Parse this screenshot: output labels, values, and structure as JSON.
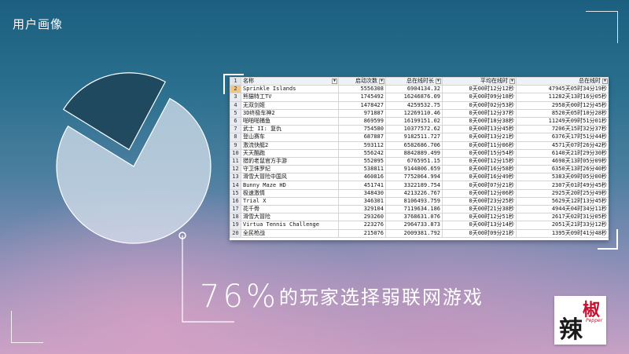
{
  "slide": {
    "title": "用户画像",
    "caption_number": "76%",
    "caption_text": "的玩家选择弱联网游戏"
  },
  "chart_data": {
    "type": "pie",
    "values": [
      76,
      24
    ],
    "colors": [
      "#d7e1ee",
      "#1e4559"
    ]
  },
  "table": {
    "headers": [
      "名称",
      "启动次数",
      "总在线时长",
      "平均在线时",
      "总在线时"
    ],
    "rows": [
      [
        "1",
        "",
        "",
        "",
        "",
        ""
      ],
      [
        "2",
        "Sprinkle Islands",
        "5556308",
        "6904134.32",
        "0天00时12分12秒",
        "47945天05时34分19秒"
      ],
      [
        "3",
        "熊猫特工TV",
        "1745492",
        "16246876.09",
        "0天00时09分18秒",
        "11282天13时16分05秒"
      ],
      [
        "4",
        "无双剑姬",
        "1478427",
        "4259532.75",
        "0天00时02分53秒",
        "2958天00时12分45秒"
      ],
      [
        "5",
        "3D终极车神2",
        "971887",
        "12269110.46",
        "0天00时12分37秒",
        "8520天05时10分28秒"
      ],
      [
        "6",
        "啪啪啪捕鱼",
        "869599",
        "16199151.02",
        "0天00时18分38秒",
        "11249天09时51分01秒"
      ],
      [
        "7",
        "武士 II: 复仇",
        "754580",
        "10377572.62",
        "0天00时13分45秒",
        "7206天15时32分37秒"
      ],
      [
        "8",
        "登山赛车",
        "687887",
        "9182511.727",
        "0天00时13分21秒",
        "6376天17时51分44秒"
      ],
      [
        "9",
        "激流快艇2",
        "593112",
        "6582686.706",
        "0天00时11分06秒",
        "4571天07时26分42秒"
      ],
      [
        "10",
        "天天酷跑",
        "556242",
        "8842889.499",
        "0天00时15分54秒",
        "6140天21时29分30秒"
      ],
      [
        "11",
        "猎豹老鼠官方手游",
        "552095",
        "6765951.15",
        "0天00时12分15秒",
        "4698天13时05分09秒"
      ],
      [
        "12",
        "守卫侏罗纪",
        "538811",
        "9144806.659",
        "0天00时16分58秒",
        "6350天13时26分40秒"
      ],
      [
        "13",
        "滑雪大冒险中国风",
        "460816",
        "7752064.994",
        "0天00时16分49秒",
        "5383天09时05分00秒"
      ],
      [
        "14",
        "Bunny Maze HD",
        "451741",
        "3322189.754",
        "0天00时07分21秒",
        "2307天01时49分45秒"
      ],
      [
        "15",
        "极速激情",
        "348430",
        "4213226.767",
        "0天00时12分06秒",
        "2925天20时25分49秒"
      ],
      [
        "16",
        "Trial X",
        "346301",
        "8106493.759",
        "0天00时23分25秒",
        "5629天12时13分45秒"
      ],
      [
        "17",
        "花千骨",
        "329104",
        "7119634.186",
        "0天00时21分38秒",
        "4944天04时34分11秒"
      ],
      [
        "18",
        "滑雪大冒险",
        "293260",
        "3768631.076",
        "0天00时12分51秒",
        "2617天02时31分05秒"
      ],
      [
        "19",
        "Virtua Tennis Challenge",
        "223276",
        "2964733.873",
        "0天00时13分14秒",
        "2051天21时33分12秒"
      ],
      [
        "20",
        "全民枪战",
        "215076",
        "2009381.792",
        "0天00时09分21秒",
        "1395天09时41分48秒"
      ]
    ]
  },
  "logo": {
    "char1": "辣",
    "char2": "椒",
    "sub": "Pepper"
  }
}
